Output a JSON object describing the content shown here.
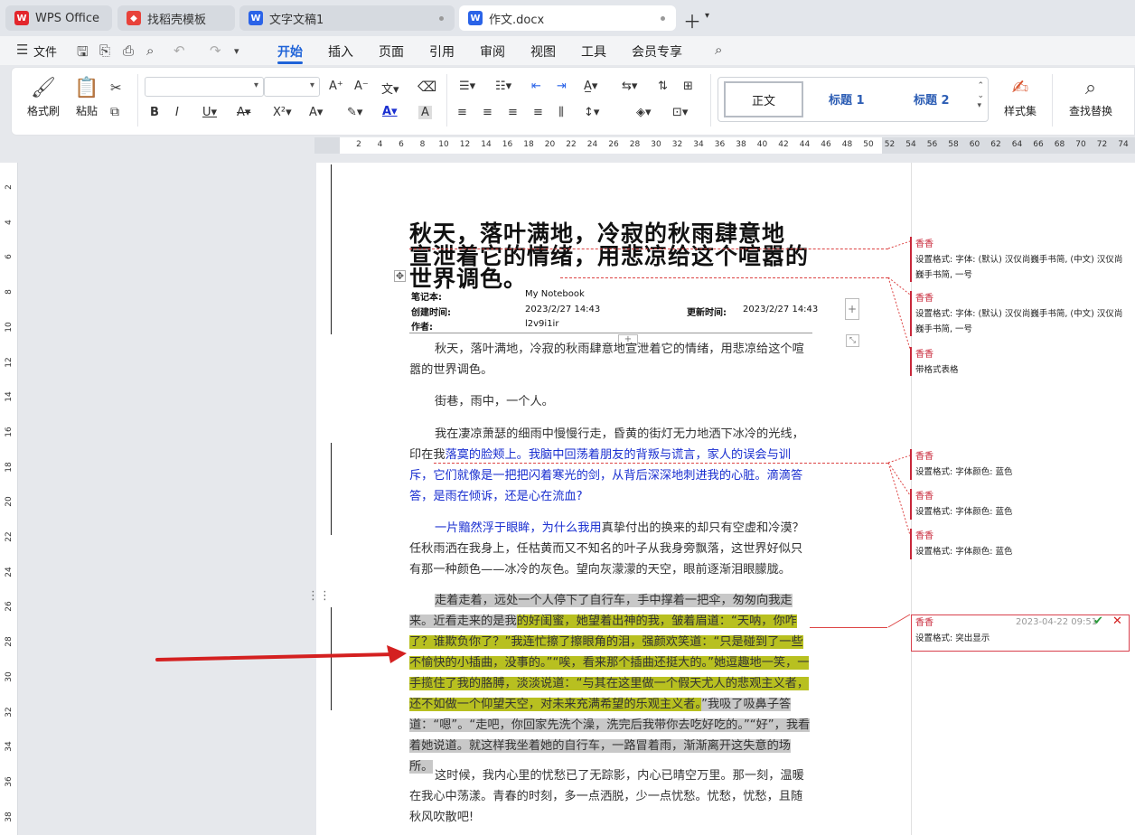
{
  "tabs": [
    {
      "label": "WPS Office",
      "icon": "wps-logo-icon",
      "color": "#e3262c"
    },
    {
      "label": "找稻壳模板",
      "icon": "docer-icon",
      "color": "#e8423a"
    },
    {
      "label": "文字文稿1",
      "icon": "writer-doc-icon",
      "color": "#2a63e8"
    },
    {
      "label": "作文.docx",
      "icon": "writer-doc-icon",
      "color": "#2a63e8"
    }
  ],
  "menu": {
    "file": "文件",
    "items": [
      "开始",
      "插入",
      "页面",
      "引用",
      "审阅",
      "视图",
      "工具",
      "会员专享"
    ]
  },
  "ribbon": {
    "format_painter": "格式刷",
    "paste": "粘贴",
    "styles": {
      "normal": "正文",
      "h1": "标题 1",
      "h2": "标题 2"
    },
    "style_set": "样式集",
    "find_replace": "查找替换"
  },
  "ruler": {
    "h_ticks": [
      "2",
      "4",
      "6",
      "8",
      "10",
      "12",
      "14",
      "16",
      "18",
      "20",
      "22",
      "24",
      "26",
      "28",
      "30",
      "32",
      "34",
      "36",
      "38",
      "40",
      "42",
      "44",
      "46",
      "48",
      "50",
      "52",
      "54",
      "56",
      "58",
      "60",
      "62",
      "64",
      "66",
      "68",
      "70",
      "72",
      "74"
    ],
    "v_ticks": [
      "2",
      "4",
      "6",
      "8",
      "10",
      "12",
      "14",
      "16",
      "18",
      "20",
      "22",
      "24",
      "26",
      "28",
      "30",
      "32",
      "34",
      "36",
      "38"
    ]
  },
  "document": {
    "title_line1": "秋天，落叶满地，冷寂的秋雨肆意地",
    "title_line2": "宣泄着它的情绪，用悲凉给这个喧嚣的世界调色。",
    "meta": {
      "notebook_label": "笔记本:",
      "notebook_value": "My Notebook",
      "created_label": "创建时间:",
      "created_value": "2023/2/27 14:43",
      "updated_label": "更新时间:",
      "updated_value": "2023/2/27 14:43",
      "author_label": "作者:",
      "author_value": "l2v9i1ir"
    },
    "p1": "秋天，落叶满地，冷寂的秋雨肆意地宣泄着它的情绪，用悲凉给这个喧嚣的世界调色。",
    "p2": "街巷，雨中，一个人。",
    "p3_a": "我在凄凉萧瑟的细雨中慢慢行走，昏黄的街灯无力地洒下冰冷的光线，印在我",
    "p3_b": "落寞的脸颊上。我脑中回荡着朋友的背叛与谎言，家人的误会与训斥，它们就像是一把把闪着寒光的剑，从背后深深地刺进我的心脏。滴滴答答，是雨在倾诉，还是心在流血?",
    "p4_a": "一片黯然浮于眼眸，为什么我用",
    "p4_b": "真挚付出的换来的却只有空虚和冷漠？任秋雨洒在我身上，任枯黄而又不知名的叶子从我身旁飘落，这世界好似只有那一种颜色——冰冷的灰色。望向灰濛濛的天空，眼前逐渐泪眼朦胧。",
    "p5_a": "走着走着，远处一个人停下了自行车，手中撑着一把伞，匆匆向我走来。近看走来的是我",
    "p5_b": "的好闺蜜，她望着出神的我，皱着眉道：“天呐，你咋了？谁欺负你了？”我连忙擦了擦眼角的泪，强颜欢笑道：“只是碰到了一些不愉快的小插曲，没事的。”“唉，看来那个插曲还挺大的。”她逗趣地一笑，一手揽住了我的胳膊，淡淡说道：“与其在这里做一个假天尤人的悲观主义者，还不如做一个仰望天空，对未来充满希望的乐观主义者。",
    "p5_c": "”我吸了吸鼻子答道：“嗯”。“走吧，你回家先洗个澡，洗完后我带你去吃好吃的。”“好”，我看着她说道。就这样我坐着她的自行车，一路冒着雨，渐渐离开这失意的场所。",
    "p6": "这时候，我内心里的忧愁已了无踪影，内心已晴空万里。那一刻，温暖在我心中荡漾。青春的时刻，多一点洒脱，少一点忧愁。忧愁，忧愁，且随秋风吹散吧!"
  },
  "comments": [
    {
      "author": "香香",
      "text": "设置格式: 字体: (默认) 汉仪尚巍手书简, (中文) 汉仪尚巍手书简, 一号"
    },
    {
      "author": "香香",
      "text": "设置格式: 字体: (默认) 汉仪尚巍手书简, (中文) 汉仪尚巍手书简, 一号"
    },
    {
      "author": "香香",
      "text": "带格式表格"
    },
    {
      "author": "香香",
      "text": "设置格式: 字体颜色: 蓝色"
    },
    {
      "author": "香香",
      "text": "设置格式: 字体颜色: 蓝色"
    },
    {
      "author": "香香",
      "text": "设置格式: 字体颜色: 蓝色"
    },
    {
      "author": "香香",
      "text": "设置格式: 突出显示",
      "time": "2023-04-22 09:51"
    }
  ]
}
